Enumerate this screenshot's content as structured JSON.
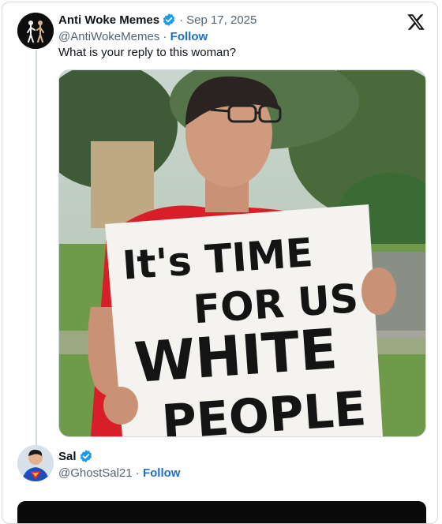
{
  "post": {
    "author": "Anti Woke Memes",
    "date": "Sep 17, 2025",
    "handle": "@AntiWokeMemes",
    "follow": "Follow",
    "text": "What is your reply to this woman?",
    "sign": {
      "line1": "It's TIME",
      "line2": "FOR US",
      "line3": "WHITE",
      "line4": "PEOPLE"
    }
  },
  "reply": {
    "author": "Sal",
    "handle": "@GhostSal21",
    "follow": "Follow"
  },
  "separator": "·",
  "colors": {
    "accent": "#1d9bf0",
    "follow": "#1d6fc4",
    "muted": "#536471",
    "text": "#0f1419",
    "shirt": "#d81e28"
  },
  "icons": [
    "x-logo-icon",
    "verified-badge-icon"
  ]
}
